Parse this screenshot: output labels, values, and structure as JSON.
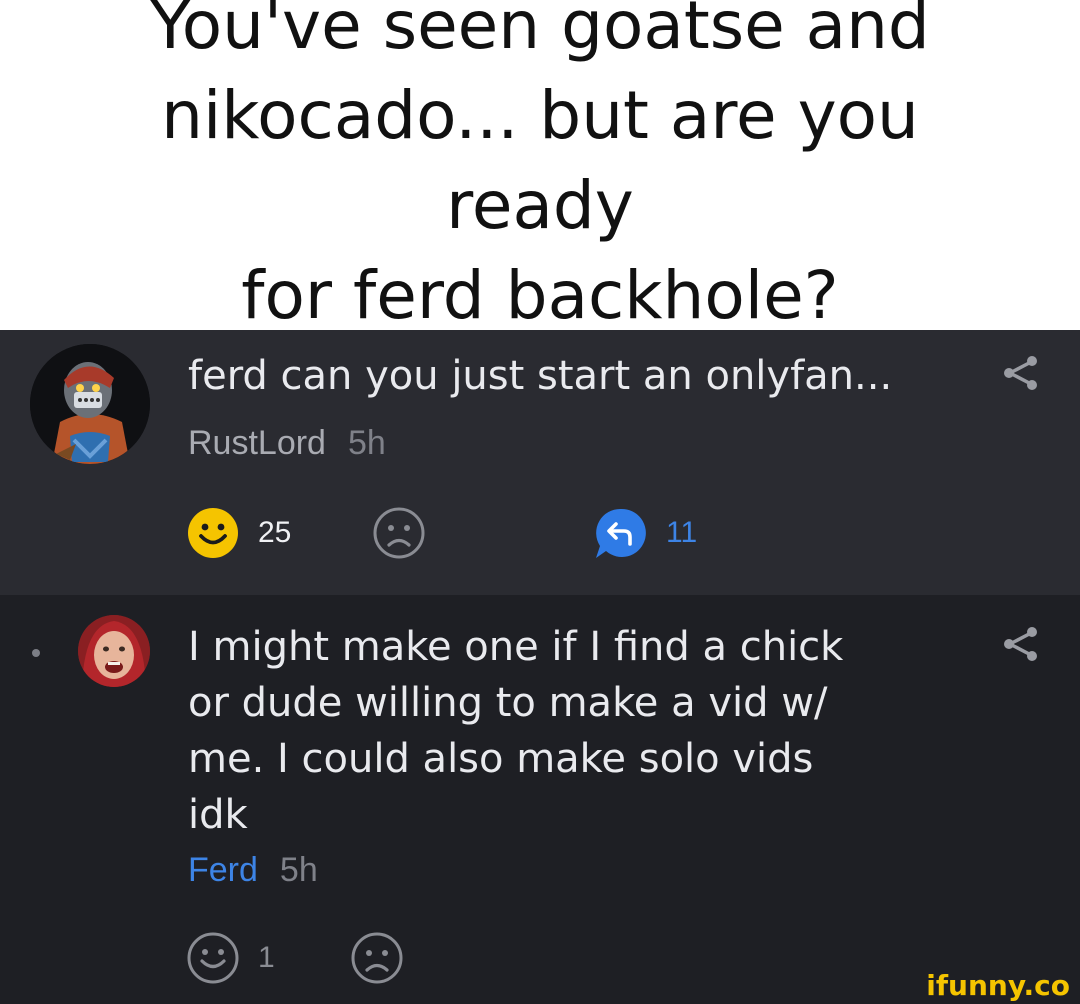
{
  "caption": {
    "line1": "You've seen goatse and",
    "line2": "nikocado... but are you ready",
    "line3": "for ferd backhole?"
  },
  "comment1": {
    "text": "ferd can you just start an onlyfan...",
    "author": "RustLord",
    "time": "5h",
    "likes": "25",
    "replies": "11",
    "colors": {
      "like": "#f5c400",
      "reply": "#2f7be6",
      "background": "#2a2b31"
    }
  },
  "comment2": {
    "line1": "I might make one if I find a chick",
    "line2": "or dude willing to make a vid w/",
    "line3": "me. I could also make solo vids",
    "line4": "idk",
    "author": "Ferd",
    "time": "5h",
    "likes": "1",
    "colors": {
      "author": "#3d84e6",
      "background": "#1e1f24"
    }
  },
  "watermark": "ifunny.co"
}
